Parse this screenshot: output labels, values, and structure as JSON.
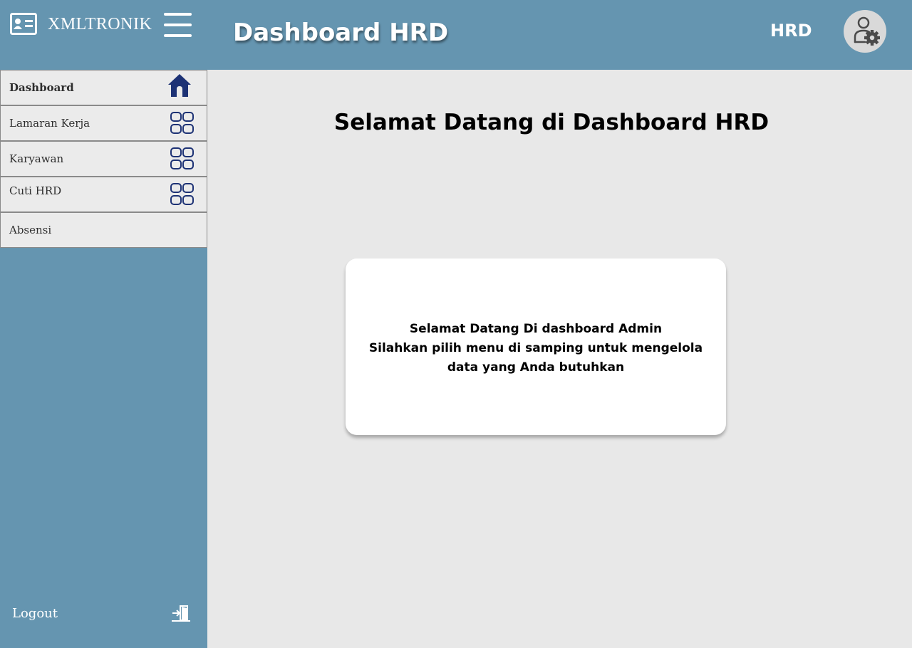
{
  "header": {
    "brand_name": "XMLTRONIK",
    "brand_icon": "id-card-icon",
    "menu_icon": "hamburger-menu-icon",
    "title": "Dashboard HRD",
    "role": "HRD",
    "avatar_icon": "user-settings-icon"
  },
  "sidebar": {
    "items": [
      {
        "label": "Dashboard",
        "icon": "home-icon",
        "active": true
      },
      {
        "label": "Lamaran Kerja",
        "icon": "grid-icon",
        "active": false
      },
      {
        "label": "Karyawan",
        "icon": "grid-icon",
        "active": false
      },
      {
        "label": "Cuti HRD",
        "icon": "grid-icon",
        "active": false
      },
      {
        "label": "Absensi",
        "icon": null,
        "active": false
      }
    ],
    "logout": {
      "label": "Logout",
      "icon": "logout-door-icon"
    }
  },
  "main": {
    "heading": "Selamat Datang di Dashboard HRD",
    "card": {
      "lines": [
        "Selamat Datang Di dashboard Admin",
        "Silahkan pilih menu di samping untuk mengelola",
        "data yang Anda butuhkan"
      ]
    }
  },
  "colors": {
    "header_bg": "#6595b0",
    "sidebar_bg": "#6595b0",
    "menu_item_bg": "#ebebeb",
    "main_bg": "#e8e8e8",
    "icon_navy": "#1d3275",
    "card_bg": "#ffffff"
  }
}
